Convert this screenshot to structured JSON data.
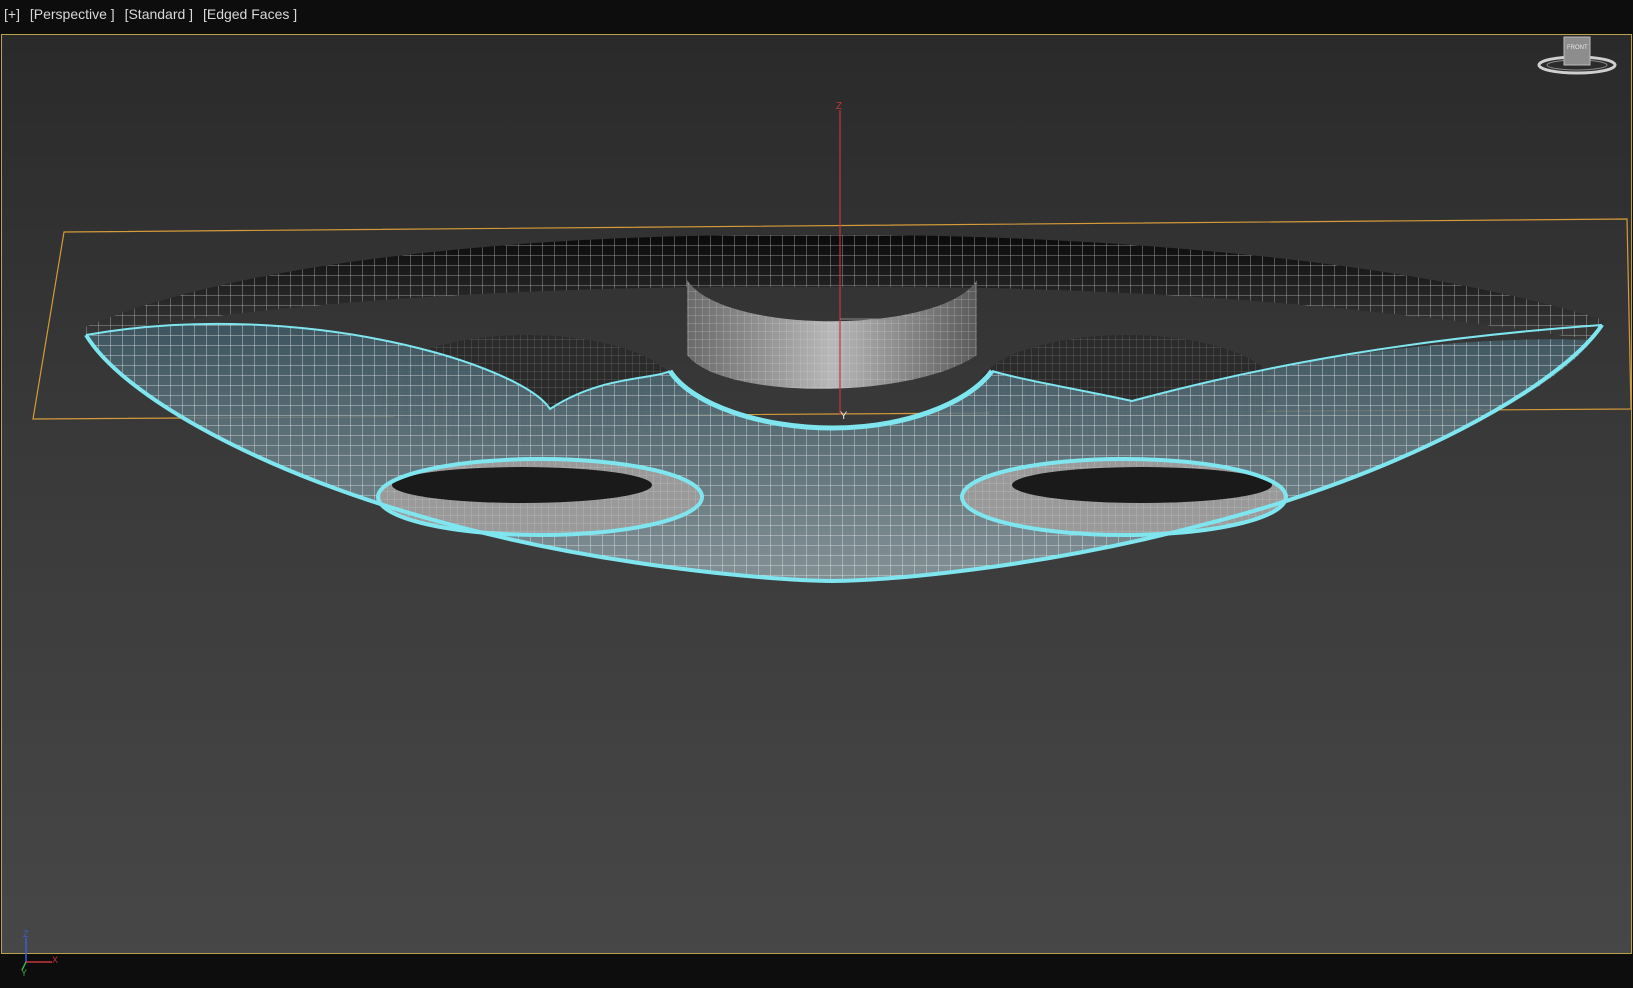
{
  "viewport": {
    "labels": {
      "plus": "[+]",
      "view": "[Perspective ]",
      "shading": "[Standard ]",
      "display": "[Edged Faces ]"
    }
  },
  "gizmo": {
    "z_label": "Z",
    "y_label": "Y"
  },
  "axis_tripod": {
    "z": "Z",
    "x": "X",
    "y": "Y"
  },
  "viewcube": {
    "face_label": "FRONT"
  },
  "colors": {
    "selection": "#7fe6f0",
    "bounding_box": "#d59a3a",
    "frame": "#b9a24a",
    "z_axis": "#c8353a"
  }
}
